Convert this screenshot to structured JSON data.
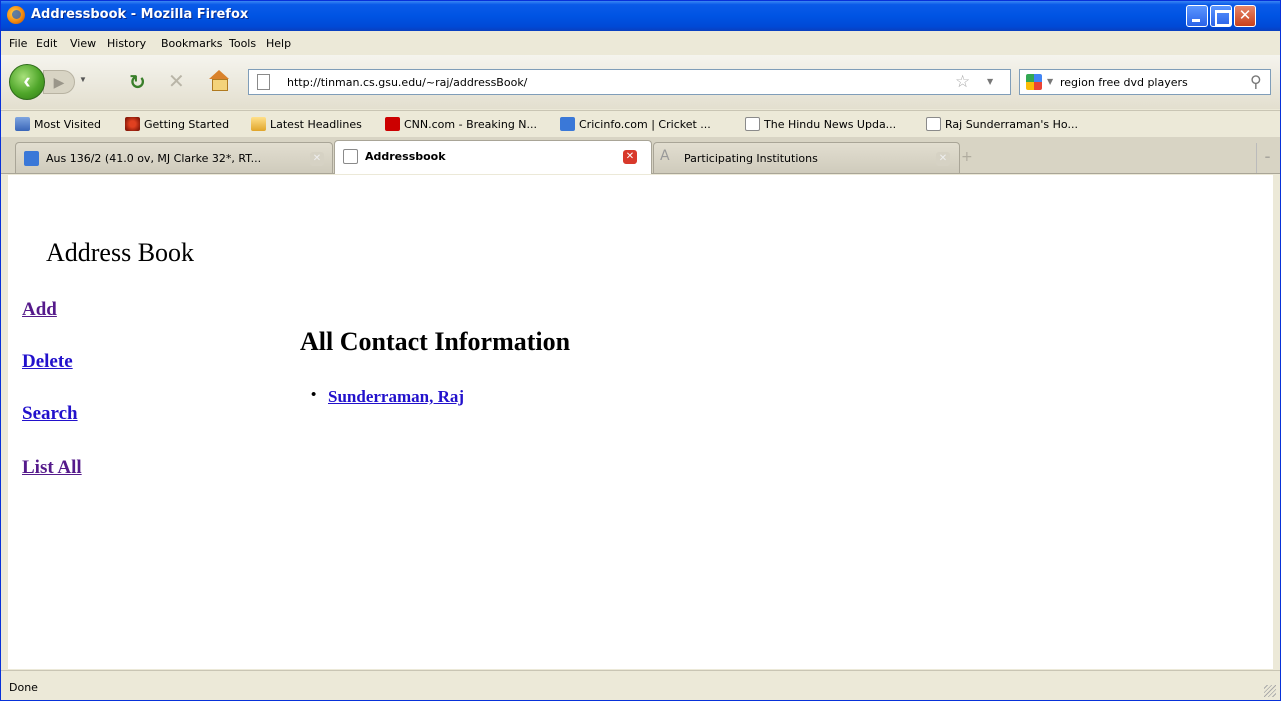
{
  "window": {
    "title": "Addressbook - Mozilla Firefox"
  },
  "menu": {
    "items": [
      "File",
      "Edit",
      "View",
      "History",
      "Bookmarks",
      "Tools",
      "Help"
    ]
  },
  "nav": {
    "url": "http://tinman.cs.gsu.edu/~raj/addressBook/",
    "search_text": "region free dvd players"
  },
  "bookmarks": {
    "items": [
      {
        "label": "Most Visited",
        "icon": "most-visited-icon"
      },
      {
        "label": "Getting Started",
        "icon": "getting-started-icon"
      },
      {
        "label": "Latest Headlines",
        "icon": "rss-folder-icon"
      },
      {
        "label": "CNN.com - Breaking N...",
        "icon": "cnn-icon"
      },
      {
        "label": "Cricinfo.com | Cricket ...",
        "icon": "cricinfo-icon"
      },
      {
        "label": "The Hindu News Upda...",
        "icon": "page-icon"
      },
      {
        "label": "Raj Sunderraman's Ho...",
        "icon": "page-icon"
      }
    ]
  },
  "tabs": [
    {
      "label": "Aus 136/2 (41.0 ov, MJ Clarke 32*, RT...",
      "active": false
    },
    {
      "label": "Addressbook",
      "active": true
    },
    {
      "label": "Participating Institutions",
      "active": false
    }
  ],
  "page": {
    "site_title": "Address Book",
    "nav_links": [
      "Add",
      "Delete",
      "Search",
      "List All"
    ],
    "main_heading": "All Contact Information",
    "contacts": [
      "Sunderraman, Raj"
    ]
  },
  "status": {
    "text": "Done"
  }
}
